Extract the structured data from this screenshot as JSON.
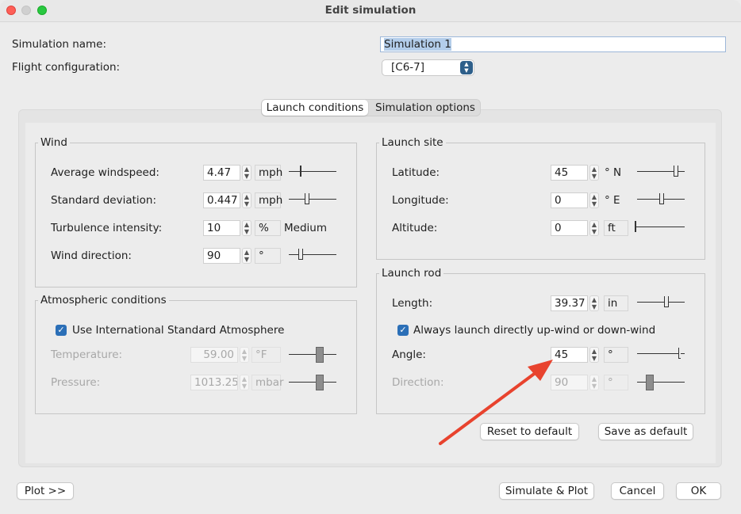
{
  "window": {
    "title": "Edit simulation"
  },
  "form": {
    "sim_name_label": "Simulation name:",
    "sim_name_value": "Simulation 1",
    "flight_config_label": "Flight configuration:",
    "flight_config_value": "[C6-7]"
  },
  "tabs": [
    {
      "label": "Launch conditions",
      "selected": true
    },
    {
      "label": "Simulation options",
      "selected": false
    }
  ],
  "wind": {
    "title": "Wind",
    "avg_label": "Average windspeed:",
    "avg_value": "4.47",
    "avg_unit": "mph",
    "std_label": "Standard deviation:",
    "std_value": "0.447",
    "std_unit": "mph",
    "turb_label": "Turbulence intensity:",
    "turb_value": "10",
    "turb_unit": "%",
    "turb_desc": "Medium",
    "dir_label": "Wind direction:",
    "dir_value": "90",
    "dir_unit": "°"
  },
  "atmos": {
    "title": "Atmospheric conditions",
    "isa_label": "Use International Standard Atmosphere",
    "isa_checked": true,
    "temp_label": "Temperature:",
    "temp_value": "59.00",
    "temp_unit": "°F",
    "press_label": "Pressure:",
    "press_value": "1013.25",
    "press_unit": "mbar"
  },
  "site": {
    "title": "Launch site",
    "lat_label": "Latitude:",
    "lat_value": "45",
    "lat_unit": "° N",
    "lon_label": "Longitude:",
    "lon_value": "0",
    "lon_unit": "° E",
    "alt_label": "Altitude:",
    "alt_value": "0",
    "alt_unit": "ft"
  },
  "rod": {
    "title": "Launch rod",
    "len_label": "Length:",
    "len_value": "39.37",
    "len_unit": "in",
    "upwind_label": "Always launch directly up-wind or down-wind",
    "upwind_checked": true,
    "angle_label": "Angle:",
    "angle_value": "45",
    "angle_unit": "°",
    "dir_label": "Direction:",
    "dir_value": "90",
    "dir_unit": "°"
  },
  "buttons": {
    "reset": "Reset to default",
    "save": "Save as default",
    "plot": "Plot >>",
    "simulate": "Simulate & Plot",
    "cancel": "Cancel",
    "ok": "OK"
  },
  "icons": {
    "arrow_color": "#e8432e",
    "checkbox_color": "#2b6fb7",
    "dropdown_color": "#2e5f8a"
  }
}
